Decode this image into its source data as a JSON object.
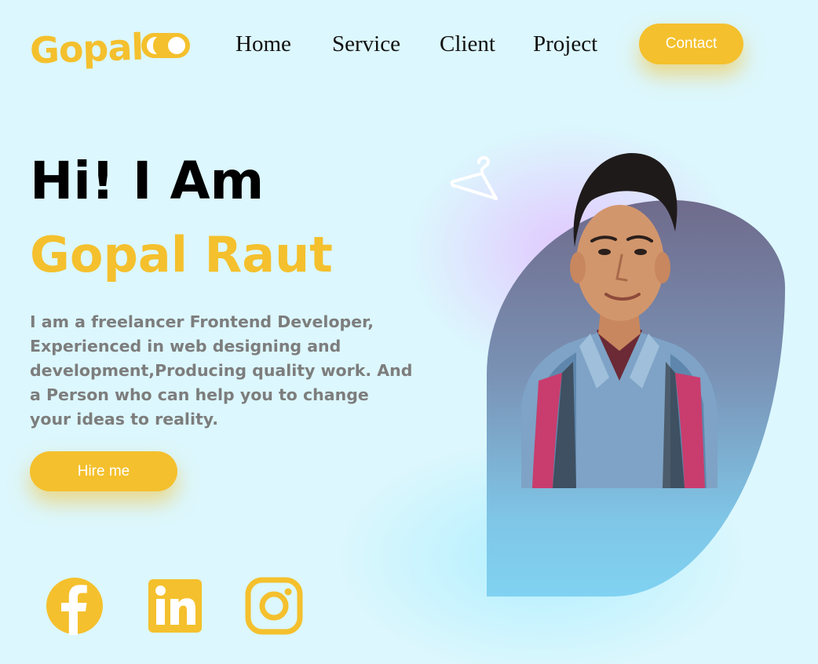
{
  "header": {
    "logo": "Gopal",
    "nav": [
      {
        "label": "Home"
      },
      {
        "label": "Service"
      },
      {
        "label": "Client"
      },
      {
        "label": "Project"
      }
    ],
    "contact_label": "Contact"
  },
  "hero": {
    "greeting": "Hi! I Am",
    "name": "Gopal Raut",
    "description": "I am  a freelancer Frontend Developer, Experienced in web designing and development,Producing quality work. And a Person who can help you to change your ideas to reality.",
    "hire_label": "Hire me"
  },
  "social": [
    {
      "icon": "facebook-icon"
    },
    {
      "icon": "linkedin-icon"
    },
    {
      "icon": "instagram-icon"
    }
  ],
  "colors": {
    "accent": "#f4c02d",
    "background": "#dcf7fd",
    "text_dark": "#111111",
    "text_muted": "#7d7d7d"
  }
}
